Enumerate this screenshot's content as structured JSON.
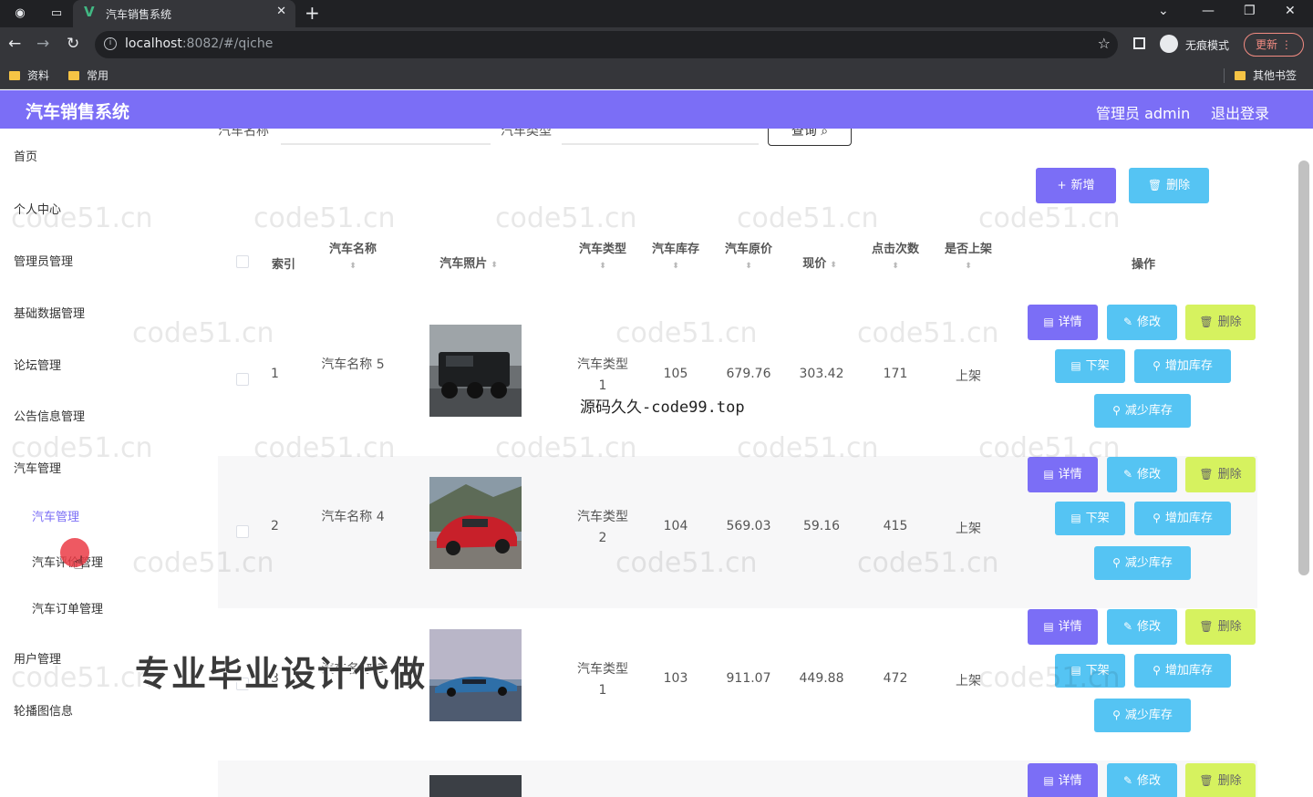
{
  "browser": {
    "tab_title": "汽车销售系统",
    "url_host": "localhost",
    "url_rest": ":8082/#/qiche",
    "incognito_label": "无痕模式",
    "update_label": "更新",
    "bookmarks": [
      "资料",
      "常用"
    ],
    "other_bookmarks": "其他书签"
  },
  "header": {
    "title": "汽车销售系统",
    "admin_label": "管理员 admin",
    "logout_label": "退出登录"
  },
  "sidebar": {
    "items": [
      {
        "label": "首页"
      },
      {
        "label": "个人中心"
      },
      {
        "label": "管理员管理"
      },
      {
        "label": "基础数据管理"
      },
      {
        "label": "论坛管理"
      },
      {
        "label": "公告信息管理"
      },
      {
        "label": "汽车管理"
      },
      {
        "label": "汽车管理"
      },
      {
        "label": "汽车评价管理"
      },
      {
        "label": "汽车订单管理"
      },
      {
        "label": "用户管理"
      },
      {
        "label": "轮播图信息"
      }
    ]
  },
  "search": {
    "name_label": "汽车名称",
    "type_label": "汽车类型",
    "query_button": "查询"
  },
  "toolbar": {
    "add_label": "新增",
    "delete_label": "删除"
  },
  "table": {
    "columns": {
      "index": "索引",
      "name": "汽车名称",
      "photo": "汽车照片",
      "type": "汽车类型",
      "stock": "汽车库存",
      "orig_price": "汽车原价",
      "price": "现价",
      "clicks": "点击次数",
      "on_shelf": "是否上架",
      "actions": "操作"
    },
    "rows": [
      {
        "index": "1",
        "name": "汽车名称 5",
        "type": "汽车类型 1",
        "stock": "105",
        "orig_price": "679.76",
        "price": "303.42",
        "clicks": "171",
        "on_shelf": "上架"
      },
      {
        "index": "2",
        "name": "汽车名称 4",
        "type": "汽车类型 2",
        "stock": "104",
        "orig_price": "569.03",
        "price": "59.16",
        "clicks": "415",
        "on_shelf": "上架"
      },
      {
        "index": "3",
        "name": "汽车名称 3",
        "type": "汽车类型 1",
        "stock": "103",
        "orig_price": "911.07",
        "price": "449.88",
        "clicks": "472",
        "on_shelf": "上架"
      }
    ],
    "actions": {
      "detail": "详情",
      "edit": "修改",
      "delete": "删除",
      "off_shelf": "下架",
      "add_stock": "增加库存",
      "reduce_stock": "减少库存"
    }
  },
  "overlays": {
    "code_text": "源码久久-code99.top",
    "promo_text": "专业毕业设计代做",
    "watermark": "code51.cn"
  },
  "colors": {
    "accent": "#7b6ef6",
    "cyan_button": "#55c4f3",
    "green_button": "#d6f25f"
  }
}
